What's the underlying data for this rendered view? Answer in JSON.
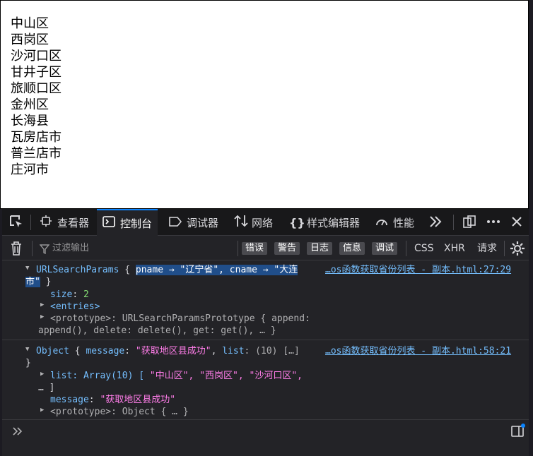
{
  "page": {
    "districts": [
      "中山区",
      "西岗区",
      "沙河口区",
      "甘井子区",
      "旅顺口区",
      "金州区",
      "长海县",
      "瓦房店市",
      "普兰店市",
      "庄河市"
    ]
  },
  "devtools": {
    "tabs": [
      {
        "label": "查看器",
        "icon": "inspector-icon"
      },
      {
        "label": "控制台",
        "icon": "console-icon",
        "active": true
      },
      {
        "label": "调试器",
        "icon": "debugger-icon"
      },
      {
        "label": "网络",
        "icon": "network-icon"
      },
      {
        "label": "样式编辑器",
        "icon": "style-editor-icon"
      },
      {
        "label": "性能",
        "icon": "performance-icon"
      }
    ],
    "filter_placeholder": "过滤输出",
    "filter_buttons": [
      "错误",
      "警告",
      "日志",
      "信息",
      "调试"
    ],
    "filter_text_buttons": [
      "CSS",
      "XHR",
      "请求"
    ],
    "accent": "#0a84ff"
  },
  "console": {
    "messages": [
      {
        "source": "…os函数获取省份列表 - 副本.html:27:29",
        "head_type": "URLSearchParams",
        "head_open": " { ",
        "head_selected": "pname → \"辽宁省\", cname → \"大连",
        "head_wrap": "市\"",
        "head_close": " }",
        "size_key": "size",
        "size_value": "2",
        "entries_label": "<entries>",
        "proto_label": "<prototype>",
        "proto_value": ": URLSearchParamsPrototype { append:",
        "proto_value_2": "append(), delete: delete(), get: get(), … }"
      },
      {
        "source": "…os函数获取省份列表 - 副本.html:58:21",
        "head_type": "Object",
        "head_open": " { ",
        "head_message_key": "message",
        "head_message_value": "\"获取地区县成功\"",
        "head_list_key": "list",
        "head_list_value": ": (10) […]",
        "head_close": "}",
        "list_key": "list",
        "list_value_prefix": ": Array(10) [ ",
        "list_items": "\"中山区\", \"西岗区\", \"沙河口区\",",
        "list_tail": "… ]",
        "message_key": "message",
        "message_value": "\"获取地区县成功\"",
        "proto_label": "<prototype>",
        "proto_value": ": Object { … }"
      }
    ]
  }
}
